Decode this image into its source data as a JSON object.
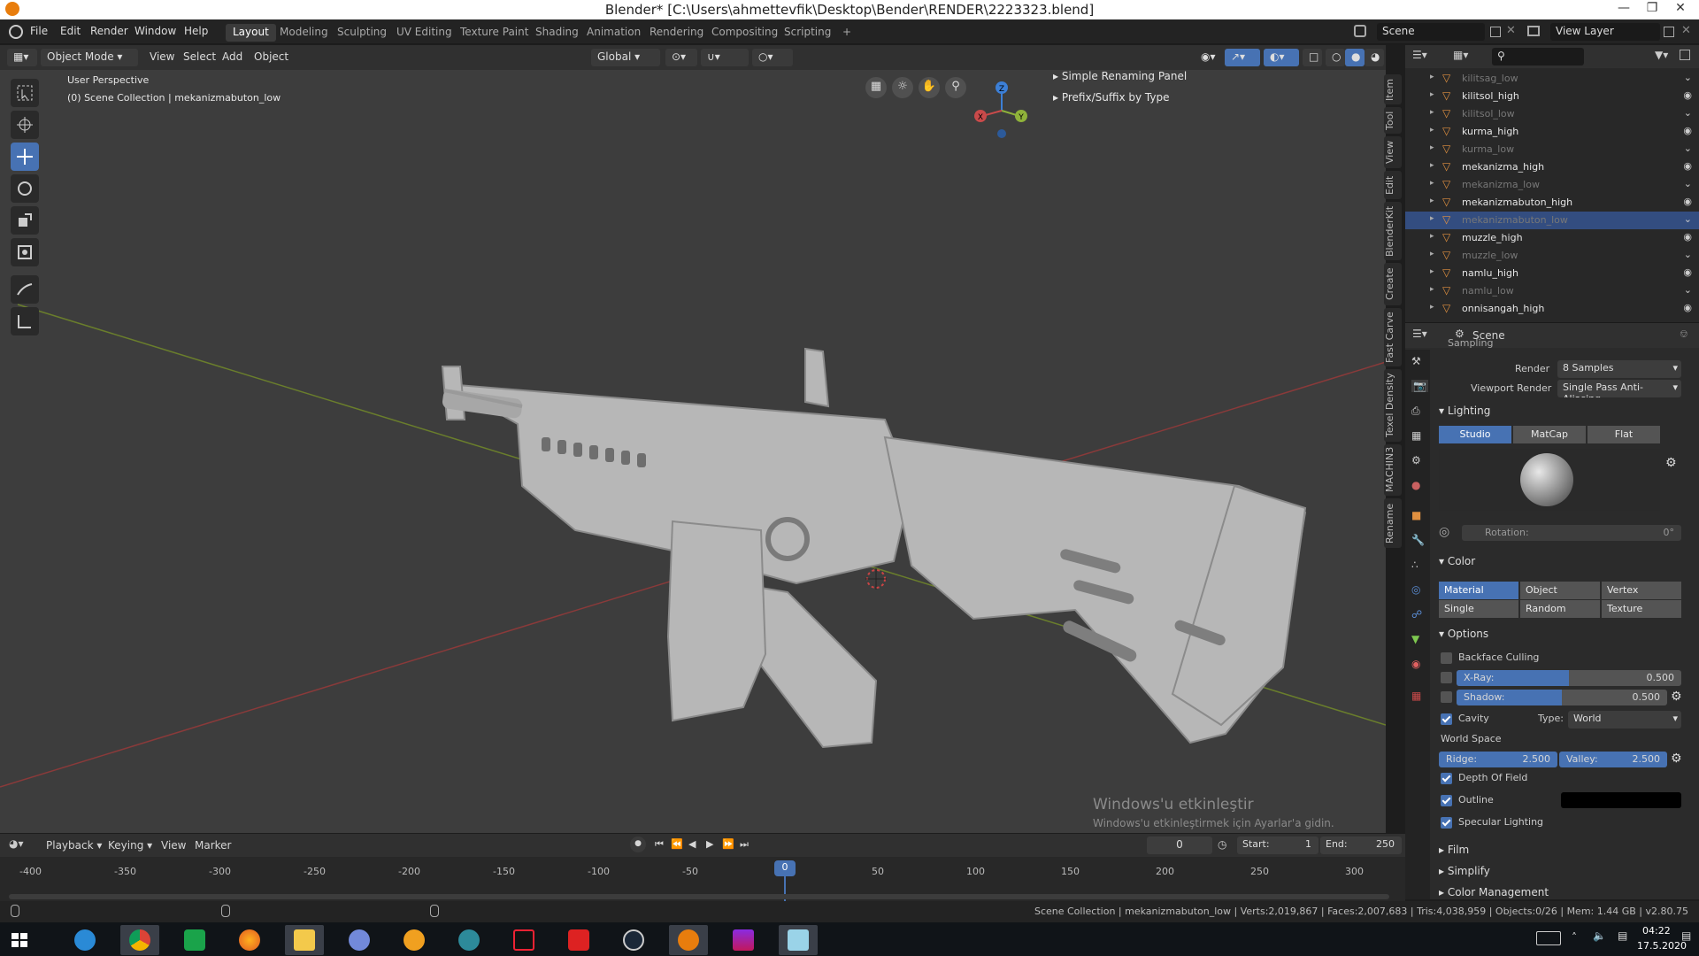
{
  "window": {
    "title": "Blender* [C:\\Users\\ahmettevfik\\Desktop\\Bender\\RENDER\\2223323.blend]"
  },
  "menu": {
    "items": [
      "File",
      "Edit",
      "Render",
      "Window",
      "Help"
    ],
    "workspaces": [
      "Layout",
      "Modeling",
      "Sculpting",
      "UV Editing",
      "Texture Paint",
      "Shading",
      "Animation",
      "Rendering",
      "Compositing",
      "Scripting"
    ],
    "active_workspace": "Layout",
    "add_symbol": "+",
    "scene_label": "Scene",
    "view_layer_label": "View Layer"
  },
  "viewport_header": {
    "mode": "Object Mode",
    "menus": [
      "View",
      "Select",
      "Add",
      "Object"
    ],
    "orientation": "Global"
  },
  "viewport": {
    "perspective": "User Perspective",
    "collection": "(0) Scene Collection | mekanizmabuton_low",
    "panels": [
      "Simple Renaming Panel",
      "Prefix/Suffix by Type"
    ],
    "gizmo": {
      "x": "X",
      "y": "Y",
      "z": "Z"
    }
  },
  "sidebar_tabs": [
    "Item",
    "Tool",
    "View",
    "Edit",
    "BlenderKit",
    "Create",
    "Fast Carve",
    "Texel Density",
    "MACHIN3",
    "Rename"
  ],
  "outliner": {
    "rows": [
      {
        "name": "kilitsag_low",
        "visible": false,
        "selected": false
      },
      {
        "name": "kilitsol_high",
        "visible": true,
        "selected": false
      },
      {
        "name": "kilitsol_low",
        "visible": false,
        "selected": false
      },
      {
        "name": "kurma_high",
        "visible": true,
        "selected": false
      },
      {
        "name": "kurma_low",
        "visible": false,
        "selected": false
      },
      {
        "name": "mekanizma_high",
        "visible": true,
        "selected": false
      },
      {
        "name": "mekanizma_low",
        "visible": false,
        "selected": false
      },
      {
        "name": "mekanizmabuton_high",
        "visible": true,
        "selected": false
      },
      {
        "name": "mekanizmabuton_low",
        "visible": false,
        "selected": true
      },
      {
        "name": "muzzle_high",
        "visible": true,
        "selected": false
      },
      {
        "name": "muzzle_low",
        "visible": false,
        "selected": false
      },
      {
        "name": "namlu_high",
        "visible": true,
        "selected": false
      },
      {
        "name": "namlu_low",
        "visible": false,
        "selected": false
      },
      {
        "name": "onnisangah_high",
        "visible": true,
        "selected": false
      }
    ]
  },
  "properties": {
    "context": "Scene",
    "sampling": {
      "title": "Sampling",
      "render_label": "Render",
      "render_value": "8 Samples",
      "viewport_render_label": "Viewport Render",
      "viewport_render_value": "Single Pass Anti-Aliasing"
    },
    "lighting": {
      "title": "Lighting",
      "options": [
        "Studio",
        "MatCap",
        "Flat"
      ],
      "selected": "Studio",
      "rotation_label": "Rotation:",
      "rotation_value": "0°"
    },
    "color": {
      "title": "Color",
      "options": [
        "Material",
        "Object",
        "Vertex",
        "Single",
        "Random",
        "Texture"
      ],
      "selected": "Material"
    },
    "options": {
      "title": "Options",
      "backface_culling": "Backface Culling",
      "xray_label": "X-Ray:",
      "xray_value": "0.500",
      "xray_fraction": 0.5,
      "shadow_label": "Shadow:",
      "shadow_value": "0.500",
      "shadow_fraction": 0.5,
      "cavity": "Cavity",
      "type_label": "Type:",
      "type_value": "World",
      "world_space": "World Space",
      "ridge_label": "Ridge:",
      "ridge_value": "2.500",
      "valley_label": "Valley:",
      "valley_value": "2.500",
      "depth_of_field": "Depth Of Field",
      "outline": "Outline",
      "outline_color": "#000000",
      "specular": "Specular Lighting"
    },
    "collapsed": [
      "Film",
      "Simplify",
      "Color Management"
    ]
  },
  "timeline": {
    "menus": [
      "Playback",
      "Keying",
      "View",
      "Marker"
    ],
    "current_frame": "0",
    "start_label": "Start:",
    "start_value": "1",
    "end_label": "End:",
    "end_value": "250",
    "ticks": [
      "-400",
      "-350",
      "-300",
      "-250",
      "-200",
      "-150",
      "-100",
      "-50",
      "0",
      "50",
      "100",
      "150",
      "200",
      "250",
      "300"
    ]
  },
  "watermark": {
    "line1": "Windows'u etkinleştir",
    "line2": "Windows'u etkinleştirmek için Ayarlar'a gidin."
  },
  "status": {
    "text": "Scene Collection | mekanizmabuton_low | Verts:2,019,867 | Faces:2,007,683 | Tris:4,038,959 | Objects:0/26 | Mem: 1.44 GB | v2.80.75"
  },
  "taskbar": {
    "time": "04:22",
    "date": "17.5.2020"
  },
  "colors": {
    "accent": "#4772b3",
    "viewport_bg": "#3d3d3d",
    "panel_bg": "#2b2b2b",
    "x_axis": "#c94a4a",
    "y_axis": "#8fb23a",
    "z_axis": "#3c7fd6"
  }
}
